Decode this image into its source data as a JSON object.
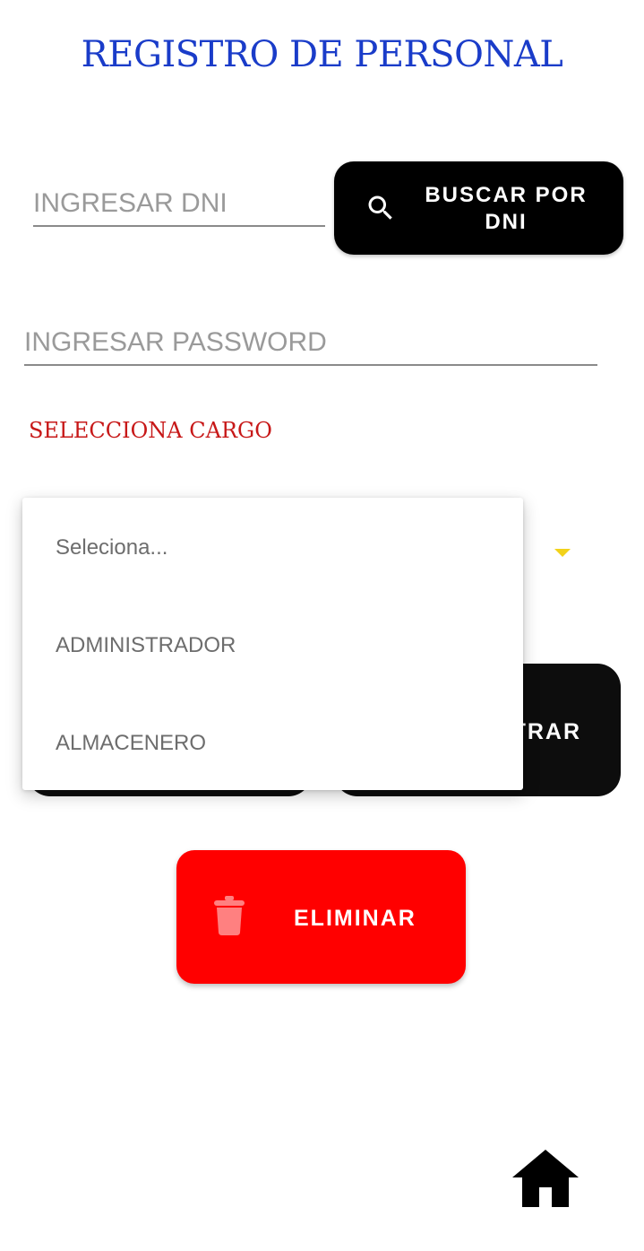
{
  "header": {
    "title": "REGISTRO DE PERSONAL"
  },
  "dni": {
    "placeholder": "INGRESAR DNI",
    "value": ""
  },
  "search_button": {
    "label": "BUSCAR POR DNI",
    "icon": "search-icon"
  },
  "password": {
    "placeholder": "INGRESAR PASSWORD",
    "value": ""
  },
  "cargo": {
    "label": "SELECCIONA CARGO",
    "options": [
      "Seleciona...",
      "ADMINISTRADOR",
      "ALMACENERO"
    ]
  },
  "register_button": {
    "label_visible": "TRAR"
  },
  "delete_button": {
    "label": "ELIMINAR",
    "icon": "trash-icon"
  },
  "nav": {
    "home_icon": "home-icon"
  },
  "colors": {
    "title": "#1a3cc9",
    "cargo_label": "#c71818",
    "primary_button": "#000000",
    "danger_button": "#ff0000",
    "spinner_arrow": "#f2d21a"
  }
}
